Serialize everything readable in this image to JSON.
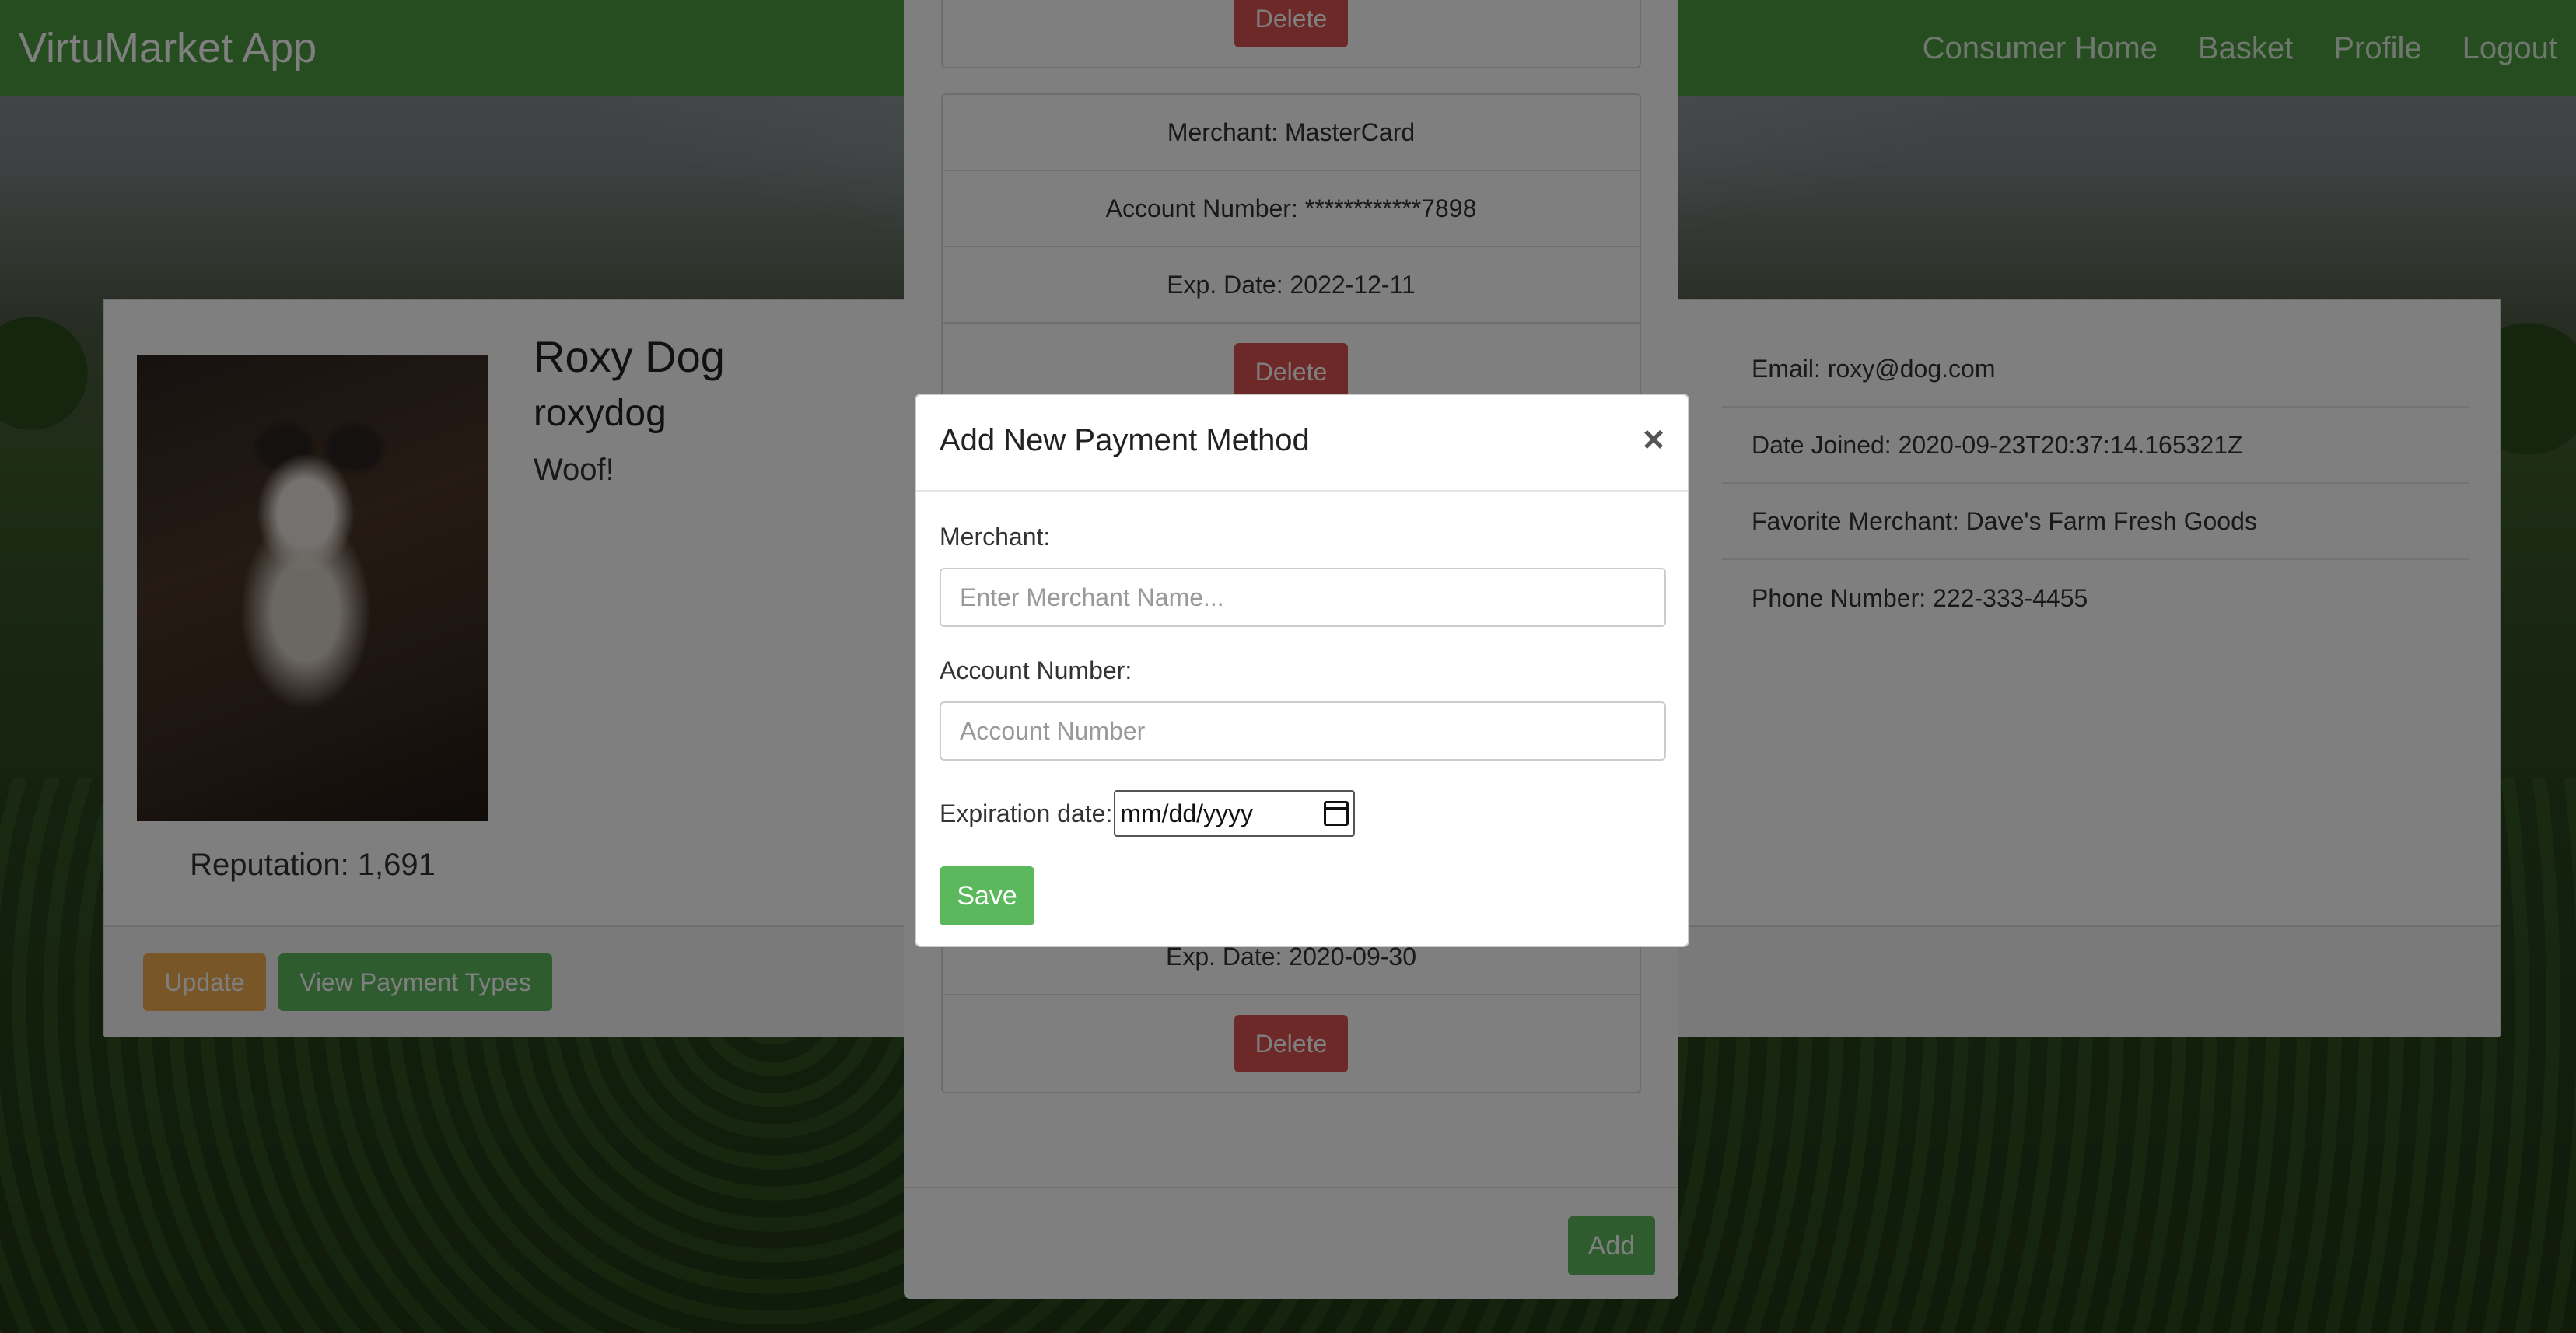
{
  "navbar": {
    "brand": "VirtuMarket App",
    "links": [
      "Consumer Home",
      "Basket",
      "Profile",
      "Logout"
    ]
  },
  "profile": {
    "name": "Roxy Dog",
    "username": "roxydog",
    "bio": "Woof!",
    "reputation": "Reputation: 1,691",
    "email": "Email: roxy@dog.com",
    "date_joined": "Date Joined: 2020-09-23T20:37:14.165321Z",
    "favorite_merchant": "Favorite Merchant: Dave's Farm Fresh Goods",
    "phone": "Phone Number: 222-333-4455",
    "update_label": "Update",
    "view_payments_label": "View Payment Types"
  },
  "payment_list": {
    "delete_label": "Delete",
    "add_label": "Add",
    "items": [
      {
        "merchant": "Merchant: MasterCard",
        "account": "Account Number: ************7898",
        "exp": "Exp. Date: 2022-12-11"
      },
      {
        "exp": "Exp. Date: 2020-09-30"
      }
    ]
  },
  "dialog": {
    "title": "Add New Payment Method",
    "close": "×",
    "merchant_label": "Merchant:",
    "merchant_placeholder": "Enter Merchant Name...",
    "account_label": "Account Number:",
    "account_placeholder": "Account Number",
    "exp_label": "Expiration date:",
    "exp_value": "mm/dd/yyyy",
    "save_label": "Save"
  }
}
